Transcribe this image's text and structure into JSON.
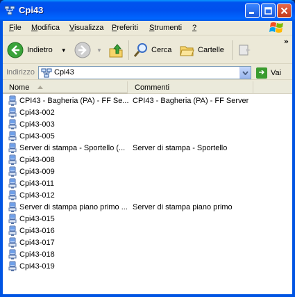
{
  "window": {
    "title": "Cpi43",
    "minimize_label": "_",
    "maximize_label": "□",
    "close_label": "×"
  },
  "menu": {
    "items": [
      {
        "underline": "F",
        "rest": "ile"
      },
      {
        "underline": "M",
        "rest": "odifica"
      },
      {
        "underline": "V",
        "rest": "isualizza"
      },
      {
        "underline": "P",
        "rest": "referiti"
      },
      {
        "underline": "S",
        "rest": "trumenti"
      },
      {
        "underline": "?",
        "rest": ""
      }
    ]
  },
  "toolbar": {
    "back_label": "Indietro",
    "search_label": "Cerca",
    "folders_label": "Cartelle",
    "overflow_label": "»"
  },
  "address": {
    "label": "Indirizzo",
    "value": "Cpi43",
    "go_label": "Vai"
  },
  "columns": {
    "name": "Nome",
    "comments": "Commenti"
  },
  "items": [
    {
      "name": "CPI43 - Bagheria (PA) - FF Se...",
      "comment": "CPI43 - Bagheria (PA) - FF Server"
    },
    {
      "name": "Cpi43-002",
      "comment": ""
    },
    {
      "name": "Cpi43-003",
      "comment": ""
    },
    {
      "name": "Cpi43-005",
      "comment": ""
    },
    {
      "name": "Server di stampa - Sportello (...",
      "comment": "Server di stampa - Sportello"
    },
    {
      "name": "Cpi43-008",
      "comment": ""
    },
    {
      "name": "Cpi43-009",
      "comment": ""
    },
    {
      "name": "Cpi43-011",
      "comment": ""
    },
    {
      "name": "Cpi43-012",
      "comment": ""
    },
    {
      "name": "Server di stampa piano primo ...",
      "comment": "Server di stampa piano primo"
    },
    {
      "name": "Cpi43-015",
      "comment": ""
    },
    {
      "name": "Cpi43-016",
      "comment": ""
    },
    {
      "name": "Cpi43-017",
      "comment": ""
    },
    {
      "name": "Cpi43-018",
      "comment": ""
    },
    {
      "name": "Cpi43-019",
      "comment": ""
    }
  ],
  "colors": {
    "titlebar": "#0054e3",
    "chrome": "#ece9d8",
    "close_button": "#d64520"
  }
}
